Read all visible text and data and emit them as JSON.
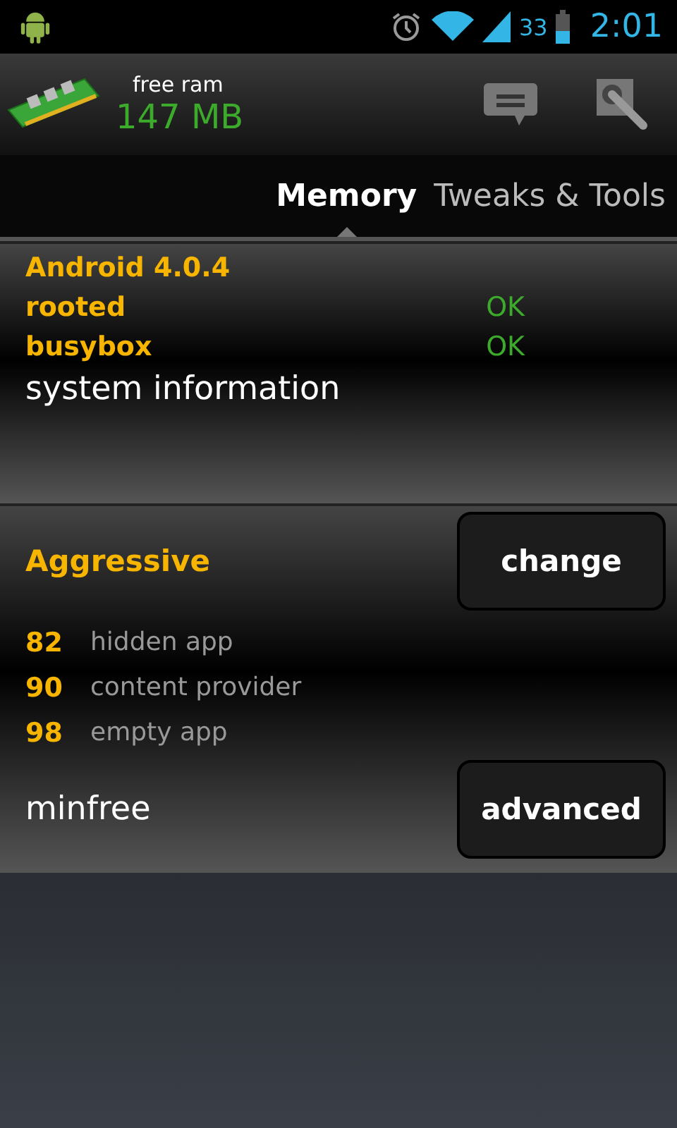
{
  "status_bar": {
    "battery_percent": "33",
    "time": "2:01"
  },
  "header": {
    "label": "free ram",
    "value": "147 MB"
  },
  "tabs": [
    {
      "label": "Memory",
      "selected": true
    },
    {
      "label": "Tweaks & Tools",
      "selected": false
    }
  ],
  "system": {
    "version": "Android 4.0.4",
    "checks": [
      {
        "label": "rooted",
        "status": "OK"
      },
      {
        "label": "busybox",
        "status": "OK"
      }
    ],
    "title": "system information"
  },
  "minfree": {
    "profile": "Aggressive",
    "change_button": "change",
    "values": [
      {
        "value": "82",
        "label": "hidden app"
      },
      {
        "value": "90",
        "label": "content provider"
      },
      {
        "value": "98",
        "label": "empty app"
      }
    ],
    "title": "minfree",
    "advanced_button": "advanced"
  }
}
